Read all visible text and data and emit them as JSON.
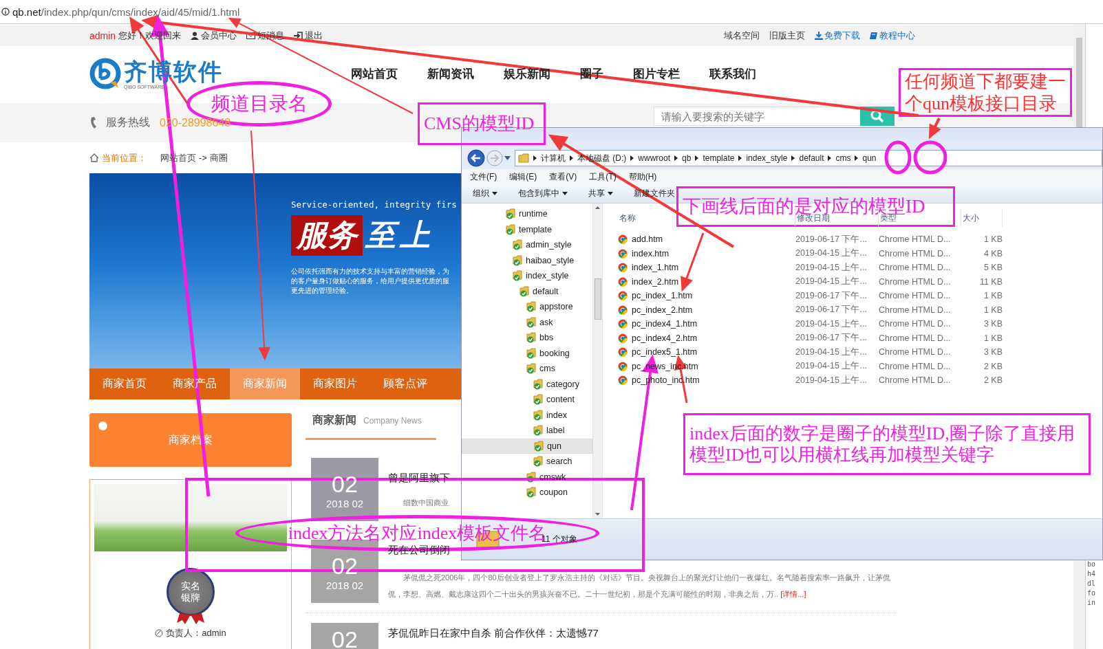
{
  "browser": {
    "url_host": "qb.net",
    "url_path": "/index.php/qun/cms/index/aid/45/mid/1.html"
  },
  "top_bar": {
    "user": "admin",
    "greeting": "您好！欢迎回来",
    "user_links": [
      "会员中心",
      "短消息",
      "退出"
    ],
    "site_links": [
      "域名空间",
      "旧版主页",
      "免费下载",
      "教程中心"
    ]
  },
  "logo": {
    "name": "齐博软件",
    "tagline": "QIBO SOFTWARE"
  },
  "main_nav": [
    "网站首页",
    "新闻资讯",
    "娱乐新闻",
    "圈子",
    "图片专栏",
    "联系我们"
  ],
  "hotline": {
    "label": "服务热线",
    "number": "020-28998648"
  },
  "search": {
    "placeholder": "请输入要搜索的关键字"
  },
  "breadcrumb": {
    "label": "当前位置：",
    "items": [
      "网站首页",
      "商圈"
    ],
    "separator": "->"
  },
  "banner": {
    "tagline": "Service-oriented, integrity firs",
    "headline_1": "服务",
    "headline_2": "至上",
    "text": [
      "公司依托强而有力的技术支持与丰富的营销经验，为",
      "的客户量身订做贴心的服务，给用户提供更优质的服",
      "更先进的管理经验。"
    ]
  },
  "shop_nav": [
    {
      "label": "商家首页",
      "selected": false
    },
    {
      "label": "商家产品",
      "selected": false
    },
    {
      "label": "商家新闻",
      "selected": true
    },
    {
      "label": "商家图片",
      "selected": false
    },
    {
      "label": "顾客点评",
      "selected": false
    }
  ],
  "profile_card": {
    "title": "商家档案",
    "medal": "实名银牌",
    "owner": "负责人：admin"
  },
  "news": {
    "title": "商家新闻",
    "subtitle": "Company News",
    "items": [
      {
        "day": "02",
        "month": "2018 02",
        "title": "曾是阿里旗下",
        "summary": "细数中国商业"
      },
      {
        "day": "02",
        "month": "2018 02",
        "title": "死在公司倒闭",
        "summary": "茅侃侃之死2006年，四个80后创业者登上了罗永浩主持的《对话》节目。央视舞台上的聚光灯让他们一夜爆红。名气随着搜索率一路飙升，让茅侃侃，李想、高燃、戴志康这四个二十出头的男孩兴奋不已。二十一世纪初，那是个充满可能性的时期，非典之后，万..",
        "more": "[详情...]"
      },
      {
        "day": "02",
        "title": "茅侃侃昨日在家中自杀 前合作伙伴：太遗憾77"
      }
    ]
  },
  "explorer": {
    "path": [
      "计算机",
      "本地磁盘 (D:)",
      "wwwroot",
      "qb",
      "template",
      "index_style",
      "default",
      "cms",
      "qun"
    ],
    "menu": [
      "文件(F)",
      "编辑(E)",
      "查看(V)",
      "工具(T)",
      "帮助(H)"
    ],
    "toolbar": [
      {
        "label": "组织",
        "dropdown": true
      },
      {
        "label": "包含到库中",
        "dropdown": true
      },
      {
        "label": "共享",
        "dropdown": true
      },
      {
        "label": "新建文件夹",
        "dropdown": false
      }
    ],
    "tree": [
      {
        "label": "runtime",
        "selected": false
      },
      {
        "label": "template",
        "selected": false,
        "children": [
          {
            "label": "admin_style",
            "selected": false
          },
          {
            "label": "haibao_style",
            "selected": false
          },
          {
            "label": "index_style",
            "selected": false,
            "children": [
              {
                "label": "default",
                "selected": false,
                "children": [
                  {
                    "label": "appstore",
                    "selected": false
                  },
                  {
                    "label": "ask",
                    "selected": false
                  },
                  {
                    "label": "bbs",
                    "selected": false
                  },
                  {
                    "label": "booking",
                    "selected": false
                  },
                  {
                    "label": "cms",
                    "selected": false,
                    "children": [
                      {
                        "label": "category",
                        "selected": false
                      },
                      {
                        "label": "content",
                        "selected": false
                      },
                      {
                        "label": "index",
                        "selected": false
                      },
                      {
                        "label": "label",
                        "selected": false
                      },
                      {
                        "label": "qun",
                        "selected": true
                      },
                      {
                        "label": "search",
                        "selected": false
                      }
                    ]
                  },
                  {
                    "label": "cmswk",
                    "selected": false
                  },
                  {
                    "label": "coupon",
                    "selected": false
                  }
                ]
              }
            ]
          }
        ]
      }
    ],
    "columns": [
      "名称",
      "修改日期",
      "类型",
      "大小"
    ],
    "files": [
      {
        "name": "add.htm",
        "modified": "2019-06-17 下午...",
        "type": "Chrome HTML D...",
        "size": "1 KB"
      },
      {
        "name": "index.htm",
        "modified": "2019-04-15 上午...",
        "type": "Chrome HTML D...",
        "size": "4 KB"
      },
      {
        "name": "index_1.htm",
        "modified": "2019-04-15 上午...",
        "type": "Chrome HTML D...",
        "size": "5 KB"
      },
      {
        "name": "index_2.htm",
        "modified": "2019-04-15 上午...",
        "type": "Chrome HTML D...",
        "size": "11 KB"
      },
      {
        "name": "pc_index_1.htm",
        "modified": "2019-06-17 下午...",
        "type": "Chrome HTML D...",
        "size": "1 KB"
      },
      {
        "name": "pc_index_2.htm",
        "modified": "2019-06-17 下午...",
        "type": "Chrome HTML D...",
        "size": "1 KB"
      },
      {
        "name": "pc_index4_1.htm",
        "modified": "2019-04-15 上午...",
        "type": "Chrome HTML D...",
        "size": "3 KB"
      },
      {
        "name": "pc_index4_2.htm",
        "modified": "2019-06-17 下午...",
        "type": "Chrome HTML D...",
        "size": "1 KB"
      },
      {
        "name": "pc_index5_1.htm",
        "modified": "2019-04-15 上午...",
        "type": "Chrome HTML D...",
        "size": "3 KB"
      },
      {
        "name": "pc_news_inc.htm",
        "modified": "2019-04-15 上午...",
        "type": "Chrome HTML D...",
        "size": "2 KB"
      },
      {
        "name": "pc_photo_inc.htm",
        "modified": "2019-04-15 上午...",
        "type": "Chrome HTML D...",
        "size": "2 KB"
      }
    ],
    "status": "11 个对象"
  },
  "devtools": {
    "lines": [
      "bo",
      "h4",
      "dl",
      "fo",
      "in"
    ]
  },
  "annotations": [
    {
      "kind": "ellipse",
      "text": "频道目录名",
      "color": "#f020e0"
    },
    {
      "kind": "box",
      "text": "CMS的模型ID",
      "color": "#f020e0"
    },
    {
      "kind": "box",
      "text": "任何频道下都要建一个qun模板接口目录",
      "color": "#ff3030"
    },
    {
      "kind": "box",
      "text": "下画线后面的是对应的模型ID",
      "color": "#f020e0"
    },
    {
      "kind": "box",
      "text": "index后面的数字是圈子的模型ID,圈子除了直接用模型ID也可以用横杠线再加模型关键字",
      "color": "#f020e0"
    },
    {
      "kind": "ellipse",
      "text": "index方法名对应index模板文件名",
      "color": "#f020e0"
    }
  ]
}
